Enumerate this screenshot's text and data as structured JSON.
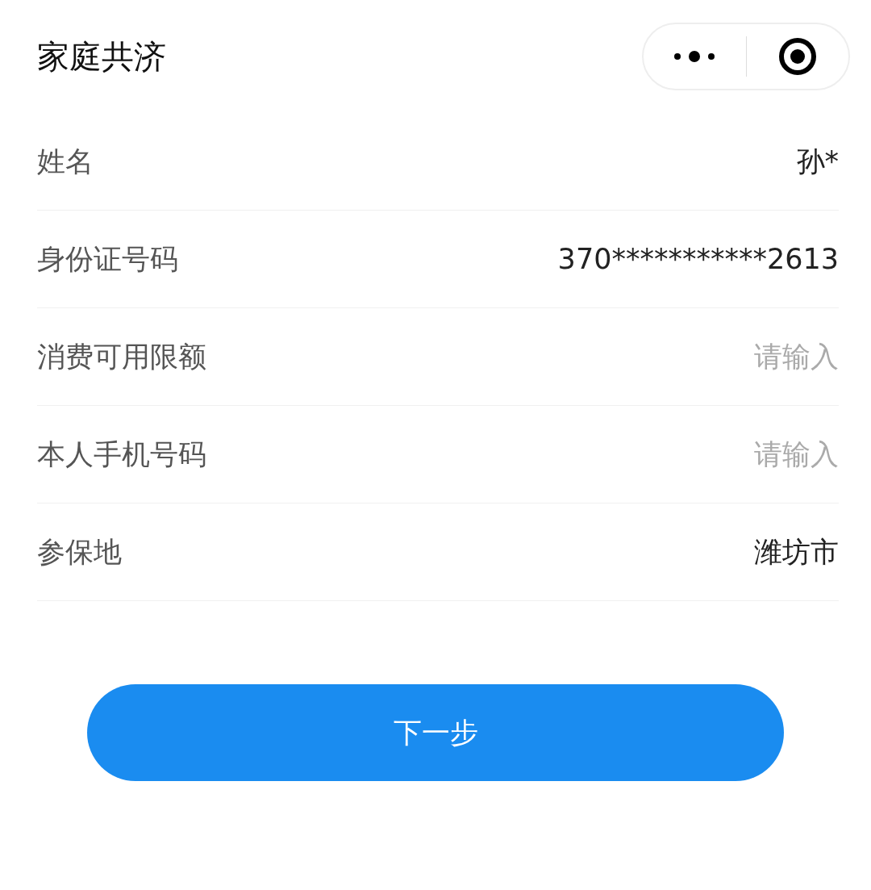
{
  "header": {
    "title": "家庭共济"
  },
  "fields": [
    {
      "label": "姓名",
      "kind": "value",
      "value": "孙*"
    },
    {
      "label": "身份证号码",
      "kind": "value",
      "value": "370***********2613"
    },
    {
      "label": "消费可用限额",
      "kind": "input",
      "placeholder": "请输入"
    },
    {
      "label": "本人手机号码",
      "kind": "input",
      "placeholder": "请输入"
    },
    {
      "label": "参保地",
      "kind": "value",
      "value": "潍坊市"
    }
  ],
  "next_button": {
    "label": "下一步"
  }
}
